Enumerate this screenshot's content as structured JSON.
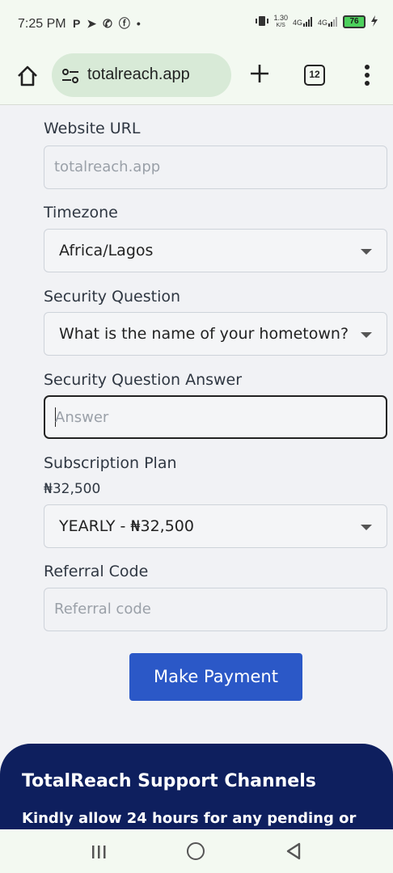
{
  "status_bar": {
    "time": "7:25 PM",
    "left_icons": [
      "P",
      "➤",
      "✆",
      "ⓕ",
      "•"
    ],
    "net_speed": "1.30",
    "net_unit": "K/S",
    "signal_1": "4G",
    "signal_2": "4G",
    "battery_level": "76"
  },
  "browser": {
    "url": "totalreach.app",
    "tab_count": "12"
  },
  "form": {
    "website_url": {
      "label": "Website URL",
      "placeholder": "totalreach.app"
    },
    "timezone": {
      "label": "Timezone",
      "value": "Africa/Lagos"
    },
    "security_question": {
      "label": "Security Question",
      "value": "What is the name of your hometown?"
    },
    "security_answer": {
      "label": "Security Question Answer",
      "placeholder": "Answer"
    },
    "subscription_plan": {
      "label": "Subscription Plan",
      "price": "₦32,500",
      "value": "YEARLY - ₦32,500"
    },
    "referral_code": {
      "label": "Referral Code",
      "placeholder": "Referral code"
    },
    "submit_label": "Make Payment"
  },
  "footer": {
    "title": "TotalReach Support Channels",
    "text": "Kindly allow 24 hours for any pending or"
  },
  "colors": {
    "accent": "#2b58c7",
    "footer_bg": "#0e1f5e",
    "chrome_bg": "#f3f9f1",
    "page_bg": "#f1f2f5"
  }
}
